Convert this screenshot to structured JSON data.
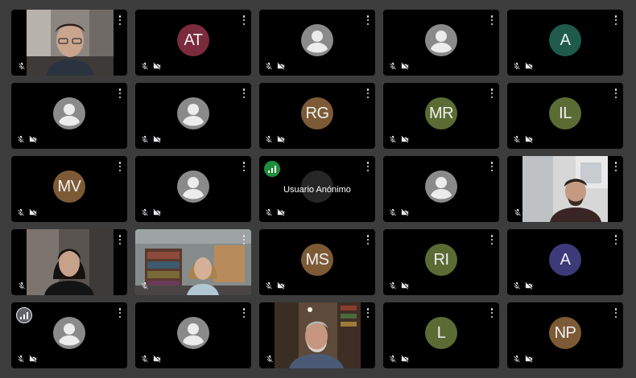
{
  "tiles": [
    {
      "kind": "video",
      "video": "man-glasses"
    },
    {
      "kind": "initials",
      "initials": "AT",
      "color": "#7a2b3c"
    },
    {
      "kind": "generic"
    },
    {
      "kind": "generic"
    },
    {
      "kind": "initials",
      "initials": "A",
      "color": "#1e5b4a"
    },
    {
      "kind": "generic"
    },
    {
      "kind": "generic"
    },
    {
      "kind": "initials",
      "initials": "RG",
      "color": "#7d5a36"
    },
    {
      "kind": "initials",
      "initials": "MR",
      "color": "#5b6b34"
    },
    {
      "kind": "initials",
      "initials": "IL",
      "color": "#5b6b34"
    },
    {
      "kind": "initials",
      "initials": "MV",
      "color": "#7d5a36"
    },
    {
      "kind": "generic"
    },
    {
      "kind": "speaking",
      "name": "Usuario Anónimo",
      "indicator": "green"
    },
    {
      "kind": "generic"
    },
    {
      "kind": "video",
      "video": "man-dark"
    },
    {
      "kind": "video",
      "video": "woman-dark"
    },
    {
      "kind": "video",
      "video": "woman-room"
    },
    {
      "kind": "initials",
      "initials": "MS",
      "color": "#7d5a36"
    },
    {
      "kind": "initials",
      "initials": "RI",
      "color": "#5b6b34"
    },
    {
      "kind": "initials",
      "initials": "A",
      "color": "#3c3a78"
    },
    {
      "kind": "generic",
      "indicator": "grey"
    },
    {
      "kind": "generic"
    },
    {
      "kind": "video",
      "video": "man-beard",
      "nocam": true
    },
    {
      "kind": "initials",
      "initials": "L",
      "color": "#5b6b34"
    },
    {
      "kind": "initials",
      "initials": "NP",
      "color": "#7d5a36"
    }
  ],
  "icons": {
    "more": "more-vert-icon",
    "mic_off": "mic-off-icon",
    "cam_off": "videocam-off-icon",
    "generic_avatar": "person-icon",
    "speaking": "audio-level-icon"
  },
  "colors": {
    "background": "#3c3c3c",
    "tile": "#000000",
    "icon": "#e8eaed",
    "speaking_green": "#1e8e3e"
  }
}
